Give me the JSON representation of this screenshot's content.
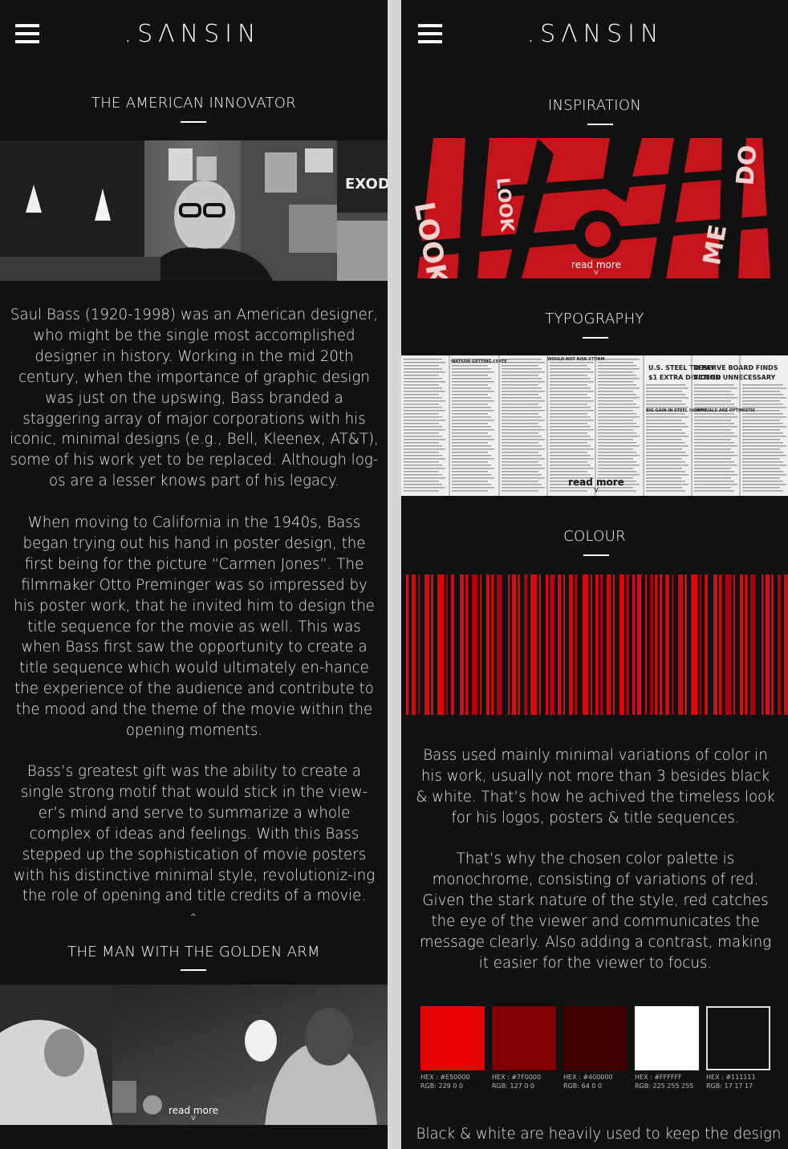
{
  "left": {
    "logo": ".SΛNSIN",
    "section_title": "THE AMERICAN INNOVATOR",
    "paragraphs": [
      "Saul Bass (1920-1998) was an American designer, who might be the single most accomplished designer in history. Working in the mid 20th century, when the importance of graphic design was just on the upswing, Bass branded a staggering array of major corporations with his iconic, minimal designs (e.g., Bell, Kleenex, AT&T), some of his work yet to be replaced. Although log-os are a lesser knows part of his legacy.",
      "When moving to California in the 1940s, Bass began trying out his hand in poster design, the first being for the picture “Carmen Jones”. The filmmaker Otto Preminger was so impressed by his poster work, that he invited him to design the title sequence for the movie as well. This was when Bass first saw the opportunity to create a title sequence which would ultimately en-hance the experience of the audience and contribute to the mood and the theme of the movie within the opening moments.",
      "Bass’s greatest gift was the ability to create a single strong motif that would stick in the view-er’s mind and serve to summarize a whole complex of ideas and feelings. With this Bass stepped up the sophistication of movie posters with his distinctive minimal style, revolutioniz-ing the role of opening and title credits of a movie."
    ],
    "up_arrow": "^",
    "section2_title": "THE MAN WITH THE GOLDEN ARM",
    "read_more": "read more",
    "chevron": "v"
  },
  "right": {
    "logo": ".SΛNSIN",
    "inspiration_title": "INSPIRATION",
    "typography_title": "TYPOGRAPHY",
    "colour_title": "COLOUR",
    "read_more_1": "read more",
    "read_more_2": "read more",
    "chevron": "v",
    "newspaper_headlines": [
      "U.S. STEEL TO PAY",
      "$1 EXTRA DIVIDEND",
      "RESERVE BOARD FINDS",
      "ACTION UNNECESSARY",
      "WATSON GETTING CERTE",
      "WOULD NOT RISK STORM",
      "BIG GAIN IN STEEL INCOME",
      "OFFICIALS ARE OPTIMISTIC"
    ],
    "poster_words": [
      "LOOK",
      "LOOK",
      "DO",
      "ME"
    ],
    "paragraphs": [
      "Bass used mainly minimal variations of color in his work, usually not more than 3 besides black & white. That’s how he achived the timeless look for his logos, posters & title sequences.",
      "That’s why the chosen color palette is monochrome, consisting of variations of red. Given the stark nature of the style, red catches the eye of the viewer and communicates the message clearly. Also adding a contrast, making it easier for the viewer to focus.",
      "Black & white are heavily used to keep the design"
    ],
    "swatches": [
      {
        "color": "#E50000",
        "hex": "HEX : #E50000",
        "rgb": "RGB: 229  0  0"
      },
      {
        "color": "#7F0000",
        "hex": "HEX : #7F0000",
        "rgb": "RGB: 127  0  0"
      },
      {
        "color": "#400000",
        "hex": "HEX : #400000",
        "rgb": "RGB: 64  0  0"
      },
      {
        "color": "#FFFFFF",
        "hex": "HEX : #FFFFFF",
        "rgb": "RGB: 225  255  255"
      },
      {
        "color": "#111111",
        "hex": "HEX : #111111",
        "rgb": "RGB: 17  17  17"
      }
    ]
  },
  "icons": {
    "menu": "hamburger-icon",
    "arrow_up": "chevron-up-icon",
    "arrow_down": "chevron-down-icon"
  }
}
